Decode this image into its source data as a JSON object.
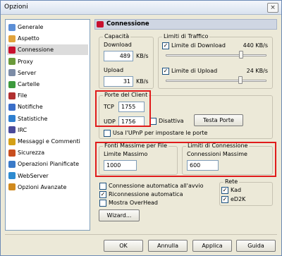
{
  "window": {
    "title": "Opzioni",
    "close_label": "×"
  },
  "sidebar": {
    "items": [
      {
        "label": "Generale",
        "icon": "gear-icon",
        "color": "#5c8fd6"
      },
      {
        "label": "Aspetto",
        "icon": "paint-icon",
        "color": "#e0a23b"
      },
      {
        "label": "Connessione",
        "icon": "connection-icon",
        "color": "#c8102e"
      },
      {
        "label": "Proxy",
        "icon": "proxy-icon",
        "color": "#6a9a3a"
      },
      {
        "label": "Server",
        "icon": "server-icon",
        "color": "#7c8ca6"
      },
      {
        "label": "Cartelle",
        "icon": "folder-icon",
        "color": "#3d9a3d"
      },
      {
        "label": "File",
        "icon": "file-icon",
        "color": "#b03030"
      },
      {
        "label": "Notifiche",
        "icon": "notify-icon",
        "color": "#3a6ec8"
      },
      {
        "label": "Statistiche",
        "icon": "stats-icon",
        "color": "#2f7fcf"
      },
      {
        "label": "IRC",
        "icon": "irc-icon",
        "color": "#4a4a9a"
      },
      {
        "label": "Messaggi e Commenti",
        "icon": "message-icon",
        "color": "#d4a017"
      },
      {
        "label": "Sicurezza",
        "icon": "security-icon",
        "color": "#c84e1e"
      },
      {
        "label": "Operazioni Pianificate",
        "icon": "schedule-icon",
        "color": "#3a7ac8"
      },
      {
        "label": "WebServer",
        "icon": "globe-icon",
        "color": "#2e8bd0"
      },
      {
        "label": "Opzioni Avanzate",
        "icon": "advanced-icon",
        "color": "#d08a1e"
      }
    ]
  },
  "panel": {
    "title": "Connessione"
  },
  "capacita": {
    "legend": "Capacità",
    "download_label": "Download",
    "download_value": "489",
    "upload_label": "Upload",
    "upload_value": "31",
    "unit": "KB/s"
  },
  "limiti_traffico": {
    "legend": "Limiti di Traffico",
    "download_label": "Limite di Download",
    "download_value": "440 KB/s",
    "download_checked": "✓",
    "upload_label": "Limite di Upload",
    "upload_value": "24 KB/s",
    "upload_checked": "✓",
    "download_level": 0.75,
    "upload_level": 0.74
  },
  "porte": {
    "legend": "Porte del Client",
    "tcp_label": "TCP",
    "tcp_value": "1755",
    "udp_label": "UDP",
    "udp_value": "1756",
    "disattiva_label": "Disattiva",
    "test_button": "Testa Porte",
    "upnp_label": "Usa l'UPnP per impostare le porte"
  },
  "fonti": {
    "legend": "Fonti Massime per File",
    "label": "Limite Massimo",
    "value": "1000"
  },
  "limiti_connessione": {
    "legend": "Limiti di Connessione",
    "label": "Connessioni Massime",
    "value": "600"
  },
  "options": {
    "auto_connect": {
      "label": "Connessione automatica all'avvio",
      "checked": ""
    },
    "reconnect": {
      "label": "Riconnessione automatica",
      "checked": "✓"
    },
    "overhead": {
      "label": "Mostra OverHead",
      "checked": ""
    }
  },
  "rete": {
    "legend": "Rete",
    "kad_label": "Kad",
    "kad_checked": "✓",
    "ed2k_label": "eD2K",
    "ed2k_checked": "✓"
  },
  "wizard_button": "Wizard...",
  "footer": {
    "ok": "OK",
    "annulla": "Annulla",
    "applica": "Applica",
    "guida": "Guida"
  },
  "highlight_color": "#e01b1b"
}
